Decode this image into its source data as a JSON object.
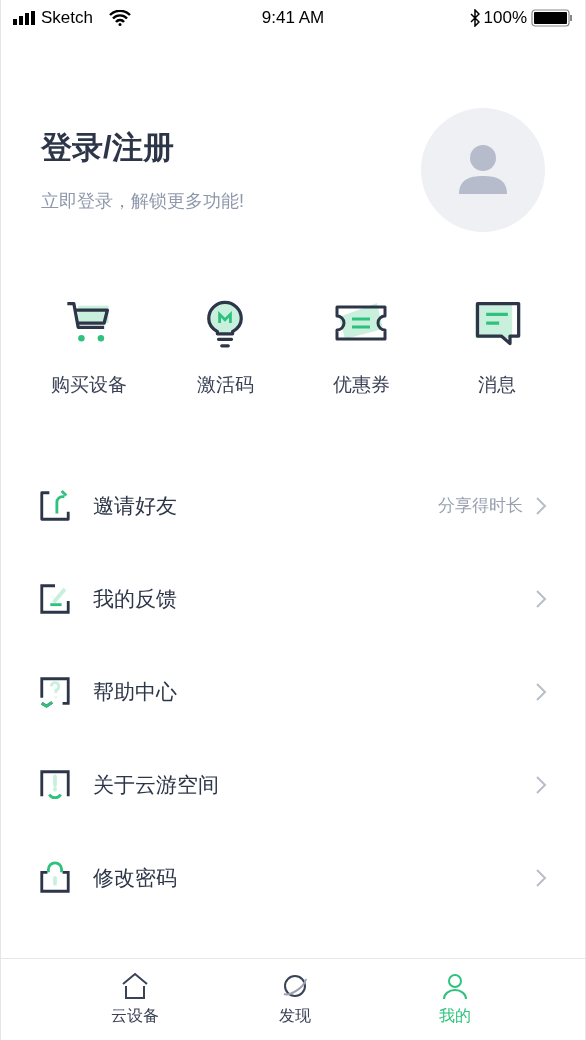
{
  "status_bar": {
    "carrier": "Sketch",
    "time": "9:41 AM",
    "battery": "100%"
  },
  "profile": {
    "title": "登录/注册",
    "subtitle": "立即登录，解锁更多功能!"
  },
  "quick_actions": [
    {
      "label": "购买设备"
    },
    {
      "label": "激活码"
    },
    {
      "label": "优惠券"
    },
    {
      "label": "消息"
    }
  ],
  "menu": [
    {
      "label": "邀请好友",
      "note": "分享得时长"
    },
    {
      "label": "我的反馈"
    },
    {
      "label": "帮助中心"
    },
    {
      "label": "关于云游空间"
    },
    {
      "label": "修改密码"
    }
  ],
  "tabs": [
    {
      "label": "云设备",
      "selected": false
    },
    {
      "label": "发现",
      "selected": false
    },
    {
      "label": "我的",
      "selected": true
    }
  ]
}
